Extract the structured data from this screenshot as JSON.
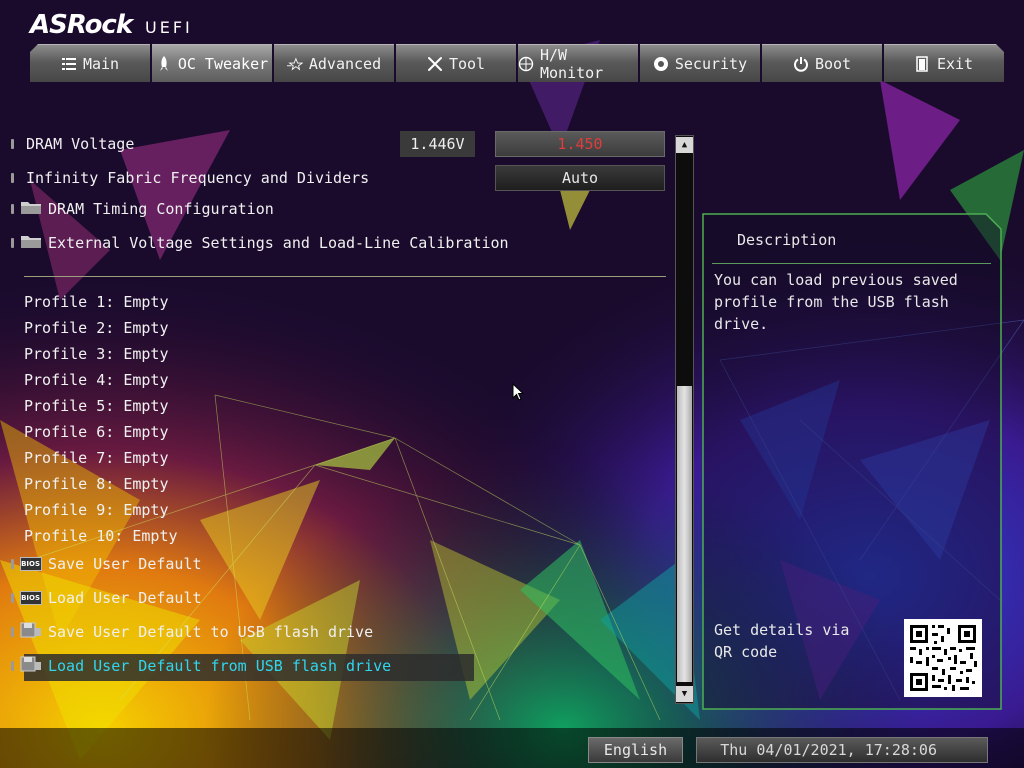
{
  "header": {
    "brand": "ASRock",
    "product": "UEFI"
  },
  "tabs": [
    {
      "label": "Main",
      "icon": "list-icon"
    },
    {
      "label": "OC Tweaker",
      "icon": "rocket-icon",
      "active": true
    },
    {
      "label": "Advanced",
      "icon": "star-icon"
    },
    {
      "label": "Tool",
      "icon": "tools-icon"
    },
    {
      "label": "H/W Monitor",
      "icon": "monitor-icon"
    },
    {
      "label": "Security",
      "icon": "shield-icon"
    },
    {
      "label": "Boot",
      "icon": "power-icon"
    },
    {
      "label": "Exit",
      "icon": "exit-icon"
    }
  ],
  "settings": {
    "dram_voltage": {
      "label": "DRAM Voltage",
      "current": "1.446V",
      "value": "1.450"
    },
    "infinity_fabric": {
      "label": "Infinity Fabric Frequency and Dividers",
      "value": "Auto"
    },
    "dram_timing": {
      "label": "DRAM Timing Configuration"
    },
    "external_voltage": {
      "label": "External Voltage Settings and Load-Line Calibration"
    }
  },
  "profiles": [
    "Profile 1: Empty",
    "Profile 2: Empty",
    "Profile 3: Empty",
    "Profile 4: Empty",
    "Profile 5: Empty",
    "Profile 6: Empty",
    "Profile 7: Empty",
    "Profile 8: Empty",
    "Profile 9: Empty",
    "Profile 10: Empty"
  ],
  "actions": {
    "save_default": "Save User Default",
    "load_default": "Load User Default",
    "save_usb": "Save User Default to USB flash drive",
    "load_usb": "Load User Default from USB flash drive",
    "bios_icon_text": "BIOS"
  },
  "description": {
    "title": "Description",
    "text": "You can load previous saved profile from the USB flash drive.",
    "qr_text": "Get details via QR code"
  },
  "footer": {
    "language": "English",
    "datetime": "Thu 04/01/2021, 17:28:06"
  },
  "colors": {
    "highlight_value": "#e03c3c",
    "selected_text": "#2fd6f0",
    "panel_border": "#4caf50"
  }
}
